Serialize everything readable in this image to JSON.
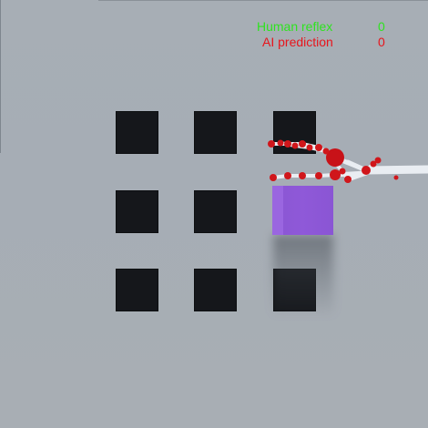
{
  "hud": {
    "human_reflex_label": "Human reflex",
    "human_reflex_value": "0",
    "ai_prediction_label": "AI prediction",
    "ai_prediction_value": "0"
  },
  "scene": {
    "grid": {
      "rows": 3,
      "columns": 3
    },
    "cube": {
      "color": "#8a55d3",
      "cell_row": 2,
      "cell_column": 3
    },
    "hand": {
      "joint_color": "#d0161b",
      "bone_color": "#e8ecf1",
      "sphere_color": "#c81218"
    }
  },
  "colors": {
    "background": "#a7aeb5",
    "cell": "#15171b",
    "human_reflex": "#2ee31f",
    "ai_prediction": "#e8151c"
  }
}
